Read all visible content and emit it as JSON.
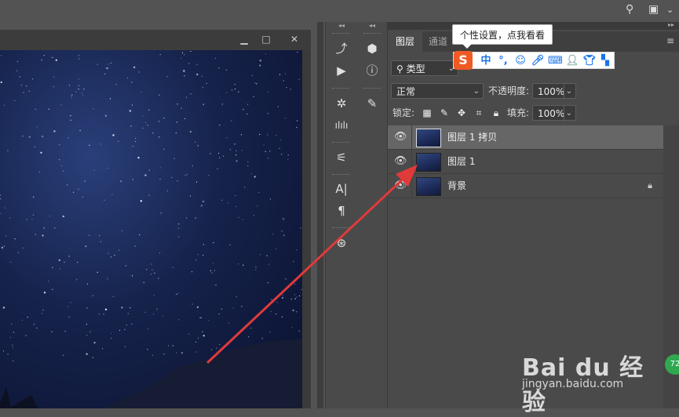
{
  "layers_panel": {
    "tabs": [
      {
        "label": "图层"
      },
      {
        "label": "通道"
      }
    ],
    "filter": {
      "value": "类型"
    },
    "blend_mode": {
      "value": "正常"
    },
    "opacity": {
      "label": "不透明度:",
      "value": "100%"
    },
    "lock": {
      "label": "锁定:"
    },
    "fill": {
      "label": "填充:",
      "value": "100%"
    },
    "layers": [
      {
        "name": "图层 1 拷贝",
        "selected": true,
        "visible": true,
        "locked": false
      },
      {
        "name": "图层 1",
        "selected": false,
        "visible": true,
        "locked": false
      },
      {
        "name": "背景",
        "selected": false,
        "visible": true,
        "locked": true
      }
    ]
  },
  "ime_toolbar": {
    "tooltip": "个性设置，点我看看",
    "logo": "S",
    "mode": "中",
    "punct": "°,"
  },
  "watermark": {
    "main": "Bai du 经验",
    "sub": "jingyan.baidu.com",
    "badge": "72"
  },
  "colors": {
    "accent_arrow": "#e03a3a",
    "panel_bg": "#4a4a4a",
    "selected_layer": "#666666"
  }
}
